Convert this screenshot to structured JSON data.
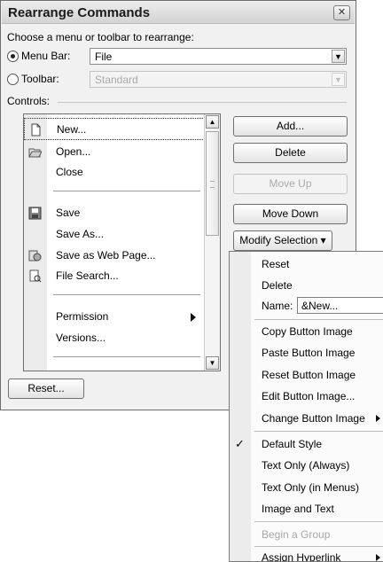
{
  "dialog": {
    "title": "Rearrange Commands",
    "choose_label": "Choose a menu or toolbar to rearrange:",
    "menu_bar_label": "Menu Bar:",
    "menu_bar_value": "File",
    "toolbar_label": "Toolbar:",
    "toolbar_value": "Standard",
    "controls_label": "Controls:",
    "reset_label": "Reset..."
  },
  "controls": [
    {
      "label": "New...",
      "icon": "new-document-icon"
    },
    {
      "label": "Open...",
      "icon": "open-folder-icon"
    },
    {
      "label": "Close",
      "icon": ""
    },
    {
      "label": "Save",
      "icon": "save-disk-icon"
    },
    {
      "label": "Save As...",
      "icon": ""
    },
    {
      "label": "Save as Web Page...",
      "icon": "web-page-icon"
    },
    {
      "label": "File Search...",
      "icon": "file-search-icon"
    },
    {
      "label": "Permission",
      "icon": "",
      "submenu": true
    },
    {
      "label": "Versions...",
      "icon": ""
    }
  ],
  "buttons": {
    "add": "Add...",
    "delete": "Delete",
    "move_up": "Move Up",
    "move_down": "Move Down",
    "modify_selection": "Modify Selection ▾"
  },
  "modify_menu": {
    "reset": "Reset",
    "delete": "Delete",
    "name_label": "Name:",
    "name_value": "&New...",
    "copy_image": "Copy Button Image",
    "paste_image": "Paste Button Image",
    "reset_image": "Reset Button Image",
    "edit_image": "Edit Button Image...",
    "change_image": "Change Button Image",
    "default_style": "Default Style",
    "text_only_always": "Text Only (Always)",
    "text_only_menus": "Text Only (in Menus)",
    "image_and_text": "Image and Text",
    "begin_group": "Begin a Group",
    "assign_hyperlink": "Assign Hyperlink"
  }
}
